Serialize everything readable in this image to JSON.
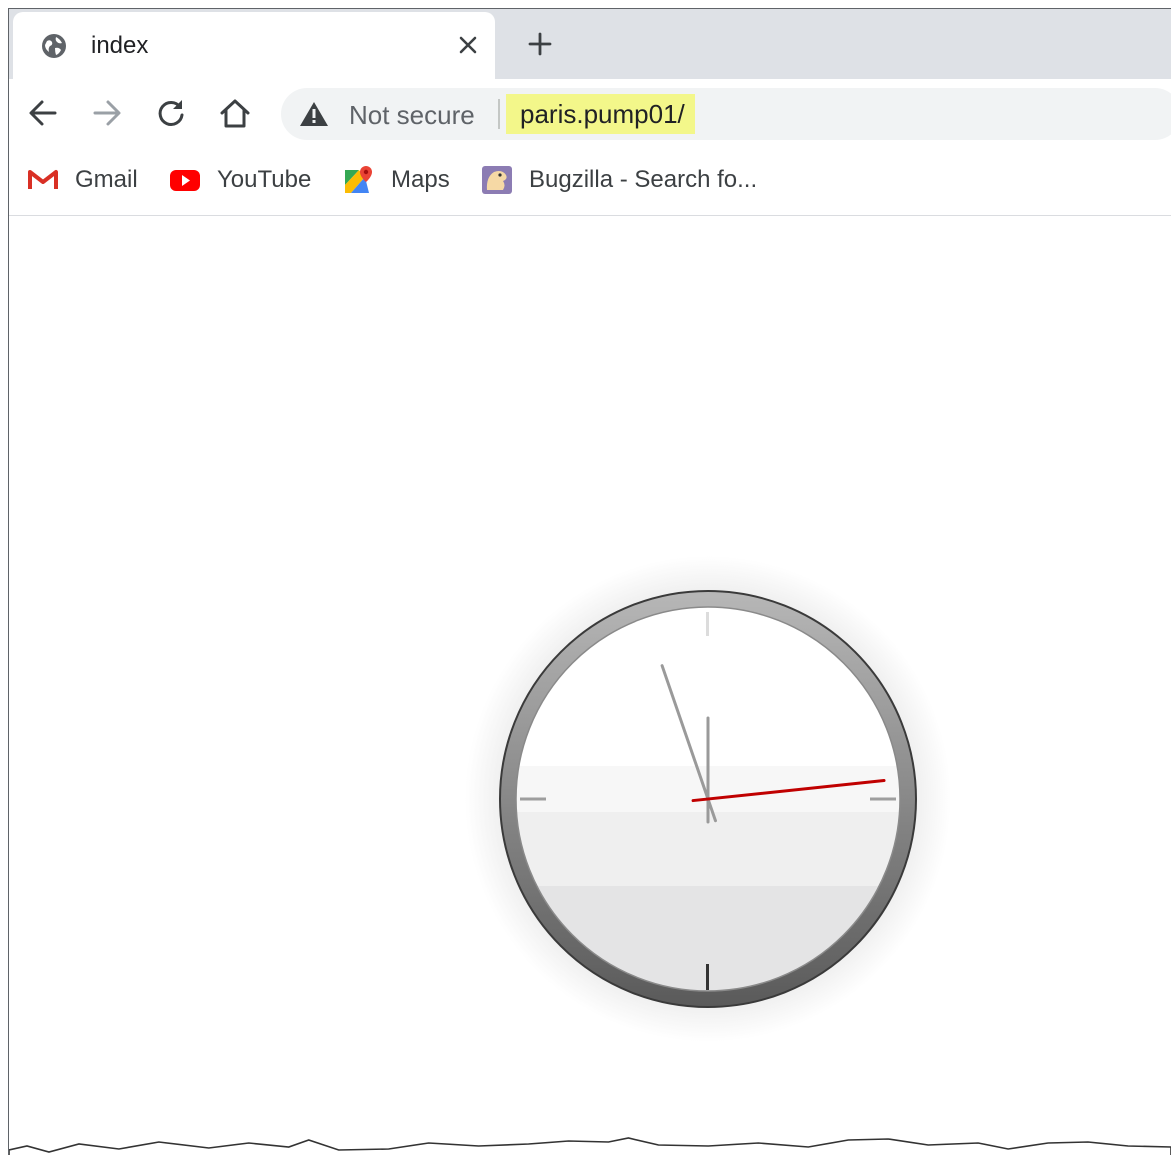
{
  "browser": {
    "tab": {
      "title": "index",
      "favicon": "globe-icon",
      "close_icon": "close-icon"
    },
    "new_tab_icon": "plus-icon",
    "nav": {
      "back_icon": "arrow-left-icon",
      "forward_icon": "arrow-right-icon",
      "reload_icon": "reload-icon",
      "home_icon": "home-icon"
    },
    "omnibox": {
      "security_icon": "warning-icon",
      "security_text": "Not secure",
      "url": "paris.pump01/",
      "url_highlight": "#f3f78a"
    },
    "bookmarks": [
      {
        "label": "Gmail",
        "icon": "gmail-icon"
      },
      {
        "label": "YouTube",
        "icon": "youtube-icon"
      },
      {
        "label": "Maps",
        "icon": "maps-icon"
      },
      {
        "label": "Bugzilla - Search fo...",
        "icon": "bugzilla-icon"
      }
    ]
  },
  "page": {
    "clock": {
      "hour_hand_angle_deg": 0,
      "minute_hand_angle_deg": -19,
      "second_hand_angle_deg": 84,
      "second_hand_color": "#c00000"
    }
  },
  "colors": {
    "tabstrip": "#dee1e6",
    "omnibox": "#f1f3f4"
  }
}
